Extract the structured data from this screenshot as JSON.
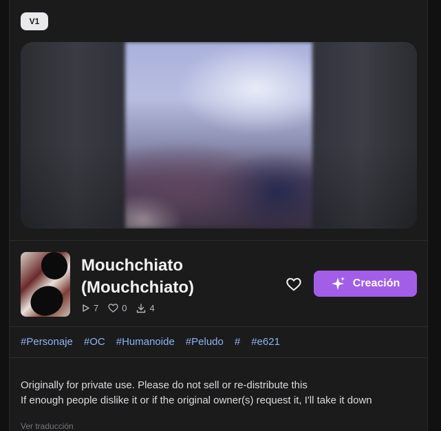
{
  "version_badge": "V1",
  "model": {
    "title_line1": "Mouchchiato",
    "title_line2": "(Mouchchiato)",
    "stats": {
      "runs": "7",
      "likes": "0",
      "downloads": "4"
    }
  },
  "actions": {
    "create_label": "Creación"
  },
  "tags": [
    "#Personaje",
    "#OC",
    "#Humanoide",
    "#Peludo",
    "#",
    "#e621"
  ],
  "description": [
    "Originally for private use. Please do not sell or re-distribute this",
    "If enough people dislike it or if the original owner(s) request it, I'll take it down"
  ],
  "translate_label": "Ver traducción",
  "colors": {
    "accent": "#a35ee8",
    "tag": "#8fb3f2",
    "background": "#1b1b1c"
  }
}
